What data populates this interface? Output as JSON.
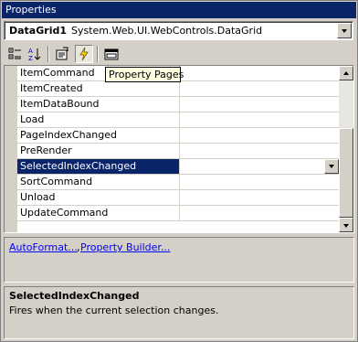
{
  "window": {
    "title": "Properties"
  },
  "object_selector": {
    "name": "DataGrid1",
    "type": "System.Web.UI.WebControls.DataGrid"
  },
  "toolbar": {
    "buttons": [
      {
        "icon": "categorized-icon"
      },
      {
        "icon": "alphabetical-icon"
      },
      {
        "icon": "properties-icon"
      },
      {
        "icon": "events-icon"
      },
      {
        "icon": "property-pages-icon"
      }
    ],
    "tooltip": "Property Pages"
  },
  "grid": {
    "rows": [
      {
        "name": "ItemCommand",
        "value": ""
      },
      {
        "name": "ItemCreated",
        "value": ""
      },
      {
        "name": "ItemDataBound",
        "value": ""
      },
      {
        "name": "Load",
        "value": ""
      },
      {
        "name": "PageIndexChanged",
        "value": ""
      },
      {
        "name": "PreRender",
        "value": ""
      },
      {
        "name": "SelectedIndexChanged",
        "value": "",
        "selected": true
      },
      {
        "name": "SortCommand",
        "value": ""
      },
      {
        "name": "Unload",
        "value": ""
      },
      {
        "name": "UpdateCommand",
        "value": ""
      }
    ]
  },
  "verbs": {
    "auto_format": "AutoFormat...",
    "separator": ",",
    "property_builder": "Property Builder..."
  },
  "description": {
    "title": "SelectedIndexChanged",
    "text": "Fires when the current selection changes."
  },
  "colors": {
    "title_bar": "#0a246a",
    "selection": "#0a246a",
    "link": "#0000ff",
    "tooltip_bg": "#ffffe1",
    "face": "#d4d0c8"
  }
}
